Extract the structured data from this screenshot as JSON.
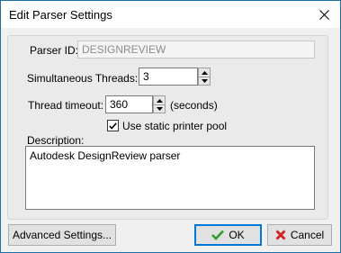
{
  "window": {
    "title": "Edit Parser Settings"
  },
  "form": {
    "parser_id_label": "Parser ID:",
    "parser_id_value": "DESIGNREVIEW",
    "threads_label": "Simultaneous Threads:",
    "threads_value": "3",
    "timeout_label": "Thread timeout:",
    "timeout_value": "360",
    "timeout_unit": "(seconds)",
    "static_pool_label": "Use static printer pool",
    "static_pool_checked": true,
    "description_label": "Description:",
    "description_value": "Autodesk DesignReview parser"
  },
  "buttons": {
    "advanced": "Advanced Settings...",
    "ok": "OK",
    "cancel": "Cancel"
  },
  "colors": {
    "window_border": "#1e6fa8",
    "ok_icon": "#2e9e2e",
    "cancel_icon": "#d32020",
    "default_button_border": "#0078d7"
  }
}
